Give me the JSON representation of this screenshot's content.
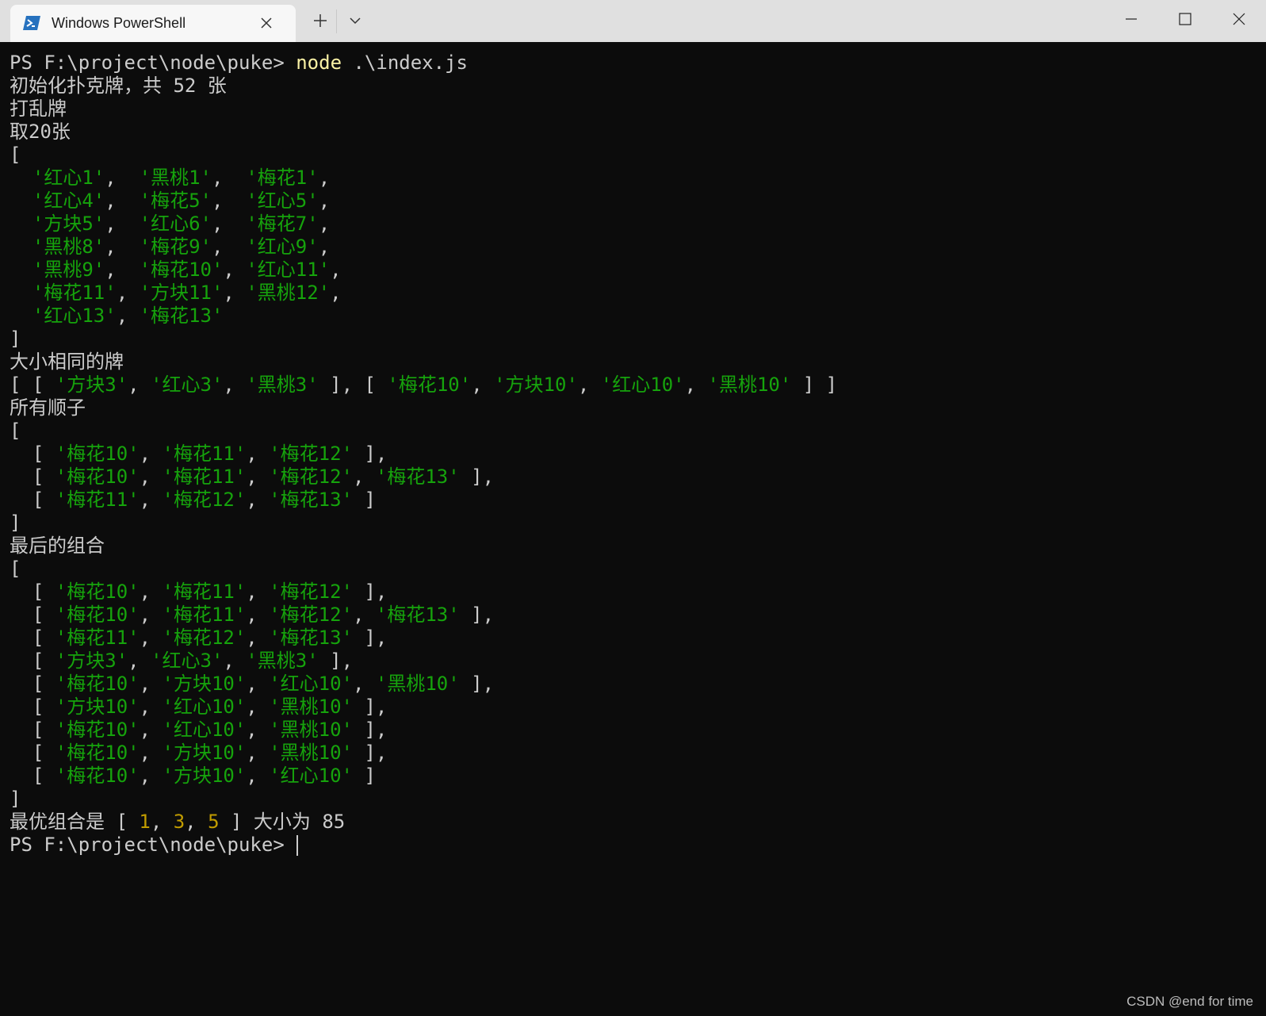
{
  "window": {
    "tab_title": "Windows PowerShell",
    "tab_icon": "powershell-icon",
    "accent": "#2671be"
  },
  "terminal": {
    "colors": {
      "default": "#cccccc",
      "string": "#16a30c",
      "command": "#f9f1a5",
      "number": "#c19c00",
      "background": "#0c0c0c"
    },
    "lines": [
      [
        {
          "t": "PS F:\\project\\node\\puke> ",
          "c": ""
        },
        {
          "t": "node",
          "c": "y"
        },
        {
          "t": " .\\index.js",
          "c": ""
        }
      ],
      [
        {
          "t": "初始化扑克牌，共 52 张",
          "c": ""
        }
      ],
      [
        {
          "t": "打乱牌",
          "c": ""
        }
      ],
      [
        {
          "t": "取20张",
          "c": ""
        }
      ],
      [
        {
          "t": "[",
          "c": ""
        }
      ],
      [
        {
          "t": "  ",
          "c": ""
        },
        {
          "t": "'红心1'",
          "c": "g"
        },
        {
          "t": ",  ",
          "c": ""
        },
        {
          "t": "'黑桃1'",
          "c": "g"
        },
        {
          "t": ",  ",
          "c": ""
        },
        {
          "t": "'梅花1'",
          "c": "g"
        },
        {
          "t": ",",
          "c": ""
        }
      ],
      [
        {
          "t": "  ",
          "c": ""
        },
        {
          "t": "'红心4'",
          "c": "g"
        },
        {
          "t": ",  ",
          "c": ""
        },
        {
          "t": "'梅花5'",
          "c": "g"
        },
        {
          "t": ",  ",
          "c": ""
        },
        {
          "t": "'红心5'",
          "c": "g"
        },
        {
          "t": ",",
          "c": ""
        }
      ],
      [
        {
          "t": "  ",
          "c": ""
        },
        {
          "t": "'方块5'",
          "c": "g"
        },
        {
          "t": ",  ",
          "c": ""
        },
        {
          "t": "'红心6'",
          "c": "g"
        },
        {
          "t": ",  ",
          "c": ""
        },
        {
          "t": "'梅花7'",
          "c": "g"
        },
        {
          "t": ",",
          "c": ""
        }
      ],
      [
        {
          "t": "  ",
          "c": ""
        },
        {
          "t": "'黑桃8'",
          "c": "g"
        },
        {
          "t": ",  ",
          "c": ""
        },
        {
          "t": "'梅花9'",
          "c": "g"
        },
        {
          "t": ",  ",
          "c": ""
        },
        {
          "t": "'红心9'",
          "c": "g"
        },
        {
          "t": ",",
          "c": ""
        }
      ],
      [
        {
          "t": "  ",
          "c": ""
        },
        {
          "t": "'黑桃9'",
          "c": "g"
        },
        {
          "t": ",  ",
          "c": ""
        },
        {
          "t": "'梅花10'",
          "c": "g"
        },
        {
          "t": ", ",
          "c": ""
        },
        {
          "t": "'红心11'",
          "c": "g"
        },
        {
          "t": ",",
          "c": ""
        }
      ],
      [
        {
          "t": "  ",
          "c": ""
        },
        {
          "t": "'梅花11'",
          "c": "g"
        },
        {
          "t": ", ",
          "c": ""
        },
        {
          "t": "'方块11'",
          "c": "g"
        },
        {
          "t": ", ",
          "c": ""
        },
        {
          "t": "'黑桃12'",
          "c": "g"
        },
        {
          "t": ",",
          "c": ""
        }
      ],
      [
        {
          "t": "  ",
          "c": ""
        },
        {
          "t": "'红心13'",
          "c": "g"
        },
        {
          "t": ", ",
          "c": ""
        },
        {
          "t": "'梅花13'",
          "c": "g"
        }
      ],
      [
        {
          "t": "]",
          "c": ""
        }
      ],
      [
        {
          "t": "大小相同的牌",
          "c": ""
        }
      ],
      [
        {
          "t": "[ [ ",
          "c": ""
        },
        {
          "t": "'方块3'",
          "c": "g"
        },
        {
          "t": ", ",
          "c": ""
        },
        {
          "t": "'红心3'",
          "c": "g"
        },
        {
          "t": ", ",
          "c": ""
        },
        {
          "t": "'黑桃3'",
          "c": "g"
        },
        {
          "t": " ], [ ",
          "c": ""
        },
        {
          "t": "'梅花10'",
          "c": "g"
        },
        {
          "t": ", ",
          "c": ""
        },
        {
          "t": "'方块10'",
          "c": "g"
        },
        {
          "t": ", ",
          "c": ""
        },
        {
          "t": "'红心10'",
          "c": "g"
        },
        {
          "t": ", ",
          "c": ""
        },
        {
          "t": "'黑桃10'",
          "c": "g"
        },
        {
          "t": " ] ]",
          "c": ""
        }
      ],
      [
        {
          "t": "所有顺子",
          "c": ""
        }
      ],
      [
        {
          "t": "[",
          "c": ""
        }
      ],
      [
        {
          "t": "  [ ",
          "c": ""
        },
        {
          "t": "'梅花10'",
          "c": "g"
        },
        {
          "t": ", ",
          "c": ""
        },
        {
          "t": "'梅花11'",
          "c": "g"
        },
        {
          "t": ", ",
          "c": ""
        },
        {
          "t": "'梅花12'",
          "c": "g"
        },
        {
          "t": " ],",
          "c": ""
        }
      ],
      [
        {
          "t": "  [ ",
          "c": ""
        },
        {
          "t": "'梅花10'",
          "c": "g"
        },
        {
          "t": ", ",
          "c": ""
        },
        {
          "t": "'梅花11'",
          "c": "g"
        },
        {
          "t": ", ",
          "c": ""
        },
        {
          "t": "'梅花12'",
          "c": "g"
        },
        {
          "t": ", ",
          "c": ""
        },
        {
          "t": "'梅花13'",
          "c": "g"
        },
        {
          "t": " ],",
          "c": ""
        }
      ],
      [
        {
          "t": "  [ ",
          "c": ""
        },
        {
          "t": "'梅花11'",
          "c": "g"
        },
        {
          "t": ", ",
          "c": ""
        },
        {
          "t": "'梅花12'",
          "c": "g"
        },
        {
          "t": ", ",
          "c": ""
        },
        {
          "t": "'梅花13'",
          "c": "g"
        },
        {
          "t": " ]",
          "c": ""
        }
      ],
      [
        {
          "t": "]",
          "c": ""
        }
      ],
      [
        {
          "t": "最后的组合",
          "c": ""
        }
      ],
      [
        {
          "t": "[",
          "c": ""
        }
      ],
      [
        {
          "t": "  [ ",
          "c": ""
        },
        {
          "t": "'梅花10'",
          "c": "g"
        },
        {
          "t": ", ",
          "c": ""
        },
        {
          "t": "'梅花11'",
          "c": "g"
        },
        {
          "t": ", ",
          "c": ""
        },
        {
          "t": "'梅花12'",
          "c": "g"
        },
        {
          "t": " ],",
          "c": ""
        }
      ],
      [
        {
          "t": "  [ ",
          "c": ""
        },
        {
          "t": "'梅花10'",
          "c": "g"
        },
        {
          "t": ", ",
          "c": ""
        },
        {
          "t": "'梅花11'",
          "c": "g"
        },
        {
          "t": ", ",
          "c": ""
        },
        {
          "t": "'梅花12'",
          "c": "g"
        },
        {
          "t": ", ",
          "c": ""
        },
        {
          "t": "'梅花13'",
          "c": "g"
        },
        {
          "t": " ],",
          "c": ""
        }
      ],
      [
        {
          "t": "  [ ",
          "c": ""
        },
        {
          "t": "'梅花11'",
          "c": "g"
        },
        {
          "t": ", ",
          "c": ""
        },
        {
          "t": "'梅花12'",
          "c": "g"
        },
        {
          "t": ", ",
          "c": ""
        },
        {
          "t": "'梅花13'",
          "c": "g"
        },
        {
          "t": " ],",
          "c": ""
        }
      ],
      [
        {
          "t": "  [ ",
          "c": ""
        },
        {
          "t": "'方块3'",
          "c": "g"
        },
        {
          "t": ", ",
          "c": ""
        },
        {
          "t": "'红心3'",
          "c": "g"
        },
        {
          "t": ", ",
          "c": ""
        },
        {
          "t": "'黑桃3'",
          "c": "g"
        },
        {
          "t": " ],",
          "c": ""
        }
      ],
      [
        {
          "t": "  [ ",
          "c": ""
        },
        {
          "t": "'梅花10'",
          "c": "g"
        },
        {
          "t": ", ",
          "c": ""
        },
        {
          "t": "'方块10'",
          "c": "g"
        },
        {
          "t": ", ",
          "c": ""
        },
        {
          "t": "'红心10'",
          "c": "g"
        },
        {
          "t": ", ",
          "c": ""
        },
        {
          "t": "'黑桃10'",
          "c": "g"
        },
        {
          "t": " ],",
          "c": ""
        }
      ],
      [
        {
          "t": "  [ ",
          "c": ""
        },
        {
          "t": "'方块10'",
          "c": "g"
        },
        {
          "t": ", ",
          "c": ""
        },
        {
          "t": "'红心10'",
          "c": "g"
        },
        {
          "t": ", ",
          "c": ""
        },
        {
          "t": "'黑桃10'",
          "c": "g"
        },
        {
          "t": " ],",
          "c": ""
        }
      ],
      [
        {
          "t": "  [ ",
          "c": ""
        },
        {
          "t": "'梅花10'",
          "c": "g"
        },
        {
          "t": ", ",
          "c": ""
        },
        {
          "t": "'红心10'",
          "c": "g"
        },
        {
          "t": ", ",
          "c": ""
        },
        {
          "t": "'黑桃10'",
          "c": "g"
        },
        {
          "t": " ],",
          "c": ""
        }
      ],
      [
        {
          "t": "  [ ",
          "c": ""
        },
        {
          "t": "'梅花10'",
          "c": "g"
        },
        {
          "t": ", ",
          "c": ""
        },
        {
          "t": "'方块10'",
          "c": "g"
        },
        {
          "t": ", ",
          "c": ""
        },
        {
          "t": "'黑桃10'",
          "c": "g"
        },
        {
          "t": " ],",
          "c": ""
        }
      ],
      [
        {
          "t": "  [ ",
          "c": ""
        },
        {
          "t": "'梅花10'",
          "c": "g"
        },
        {
          "t": ", ",
          "c": ""
        },
        {
          "t": "'方块10'",
          "c": "g"
        },
        {
          "t": ", ",
          "c": ""
        },
        {
          "t": "'红心10'",
          "c": "g"
        },
        {
          "t": " ]",
          "c": ""
        }
      ],
      [
        {
          "t": "]",
          "c": ""
        }
      ],
      [
        {
          "t": "最优组合是 [ ",
          "c": ""
        },
        {
          "t": "1",
          "c": "o"
        },
        {
          "t": ", ",
          "c": ""
        },
        {
          "t": "3",
          "c": "o"
        },
        {
          "t": ", ",
          "c": ""
        },
        {
          "t": "5",
          "c": "o"
        },
        {
          "t": " ] 大小为 85",
          "c": ""
        }
      ],
      [
        {
          "t": "PS F:\\project\\node\\puke> ",
          "c": ""
        }
      ]
    ]
  },
  "watermark": "CSDN @end for time"
}
